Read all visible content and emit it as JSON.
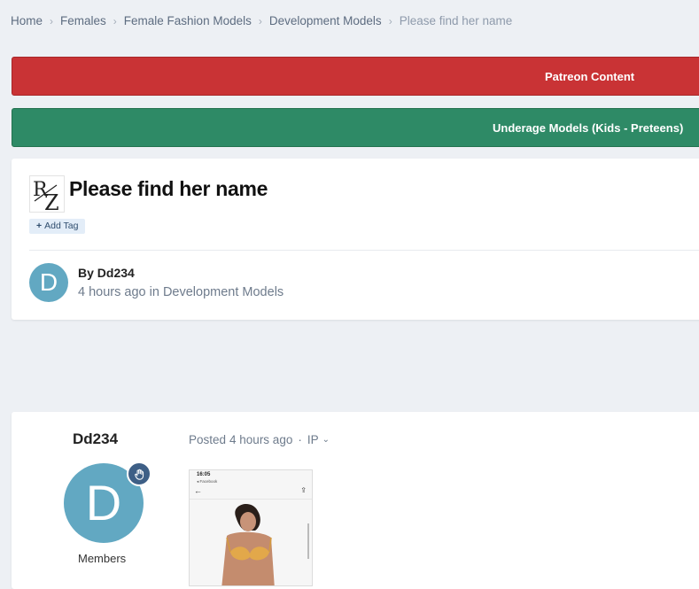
{
  "breadcrumb": [
    "Home",
    "Females",
    "Female Fashion Models",
    "Development Models",
    "Please find her name"
  ],
  "banners": {
    "patreon": "Patreon Content",
    "underage": "Underage Models (Kids - Preteens)"
  },
  "topic": {
    "title": "Please find her name",
    "add_tag": "Add Tag",
    "author_initial": "D",
    "by_label": "By",
    "author": "Dd234",
    "time": "4 hours ago",
    "in_label": "in",
    "forum": "Development Models"
  },
  "post": {
    "author": "Dd234",
    "initial": "D",
    "group": "Members",
    "posted_label": "Posted",
    "posted_time": "4 hours ago",
    "ip_label": "IP"
  },
  "attachment": {
    "status_time": "16:05",
    "status_sub": "◂ Facebook"
  },
  "colors": {
    "patreon": "#c93335",
    "underage": "#2e8a66",
    "avatar": "#62a8c2",
    "badge": "#3e5f86"
  }
}
